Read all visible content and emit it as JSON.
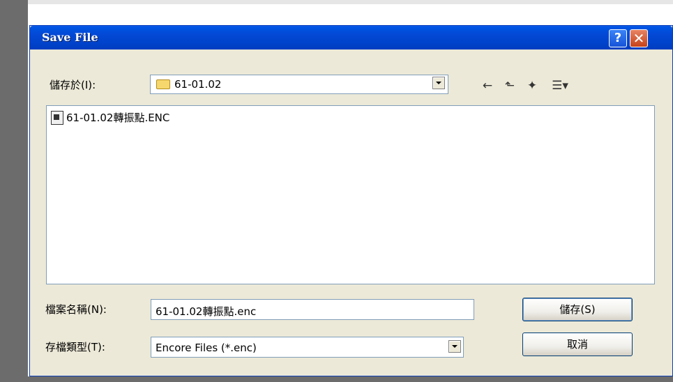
{
  "dialog": {
    "title": "Save File",
    "help_label": "?",
    "close_label": "✕"
  },
  "save_in": {
    "label": "儲存於(I):",
    "folder": "61-01.02"
  },
  "toolbar": {
    "back_icon": "←",
    "up_icon": "⬑",
    "new_folder_icon": "✦",
    "views_icon": "☰▾"
  },
  "files": [
    {
      "name": "61-01.02轉振點.ENC"
    }
  ],
  "file_name": {
    "label": "檔案名稱(N):",
    "value": "61-01.02轉振點.enc"
  },
  "file_type": {
    "label": "存檔類型(T):",
    "value": "Encore Files (*.enc)"
  },
  "buttons": {
    "save": "儲存(S)",
    "cancel": "取消"
  }
}
